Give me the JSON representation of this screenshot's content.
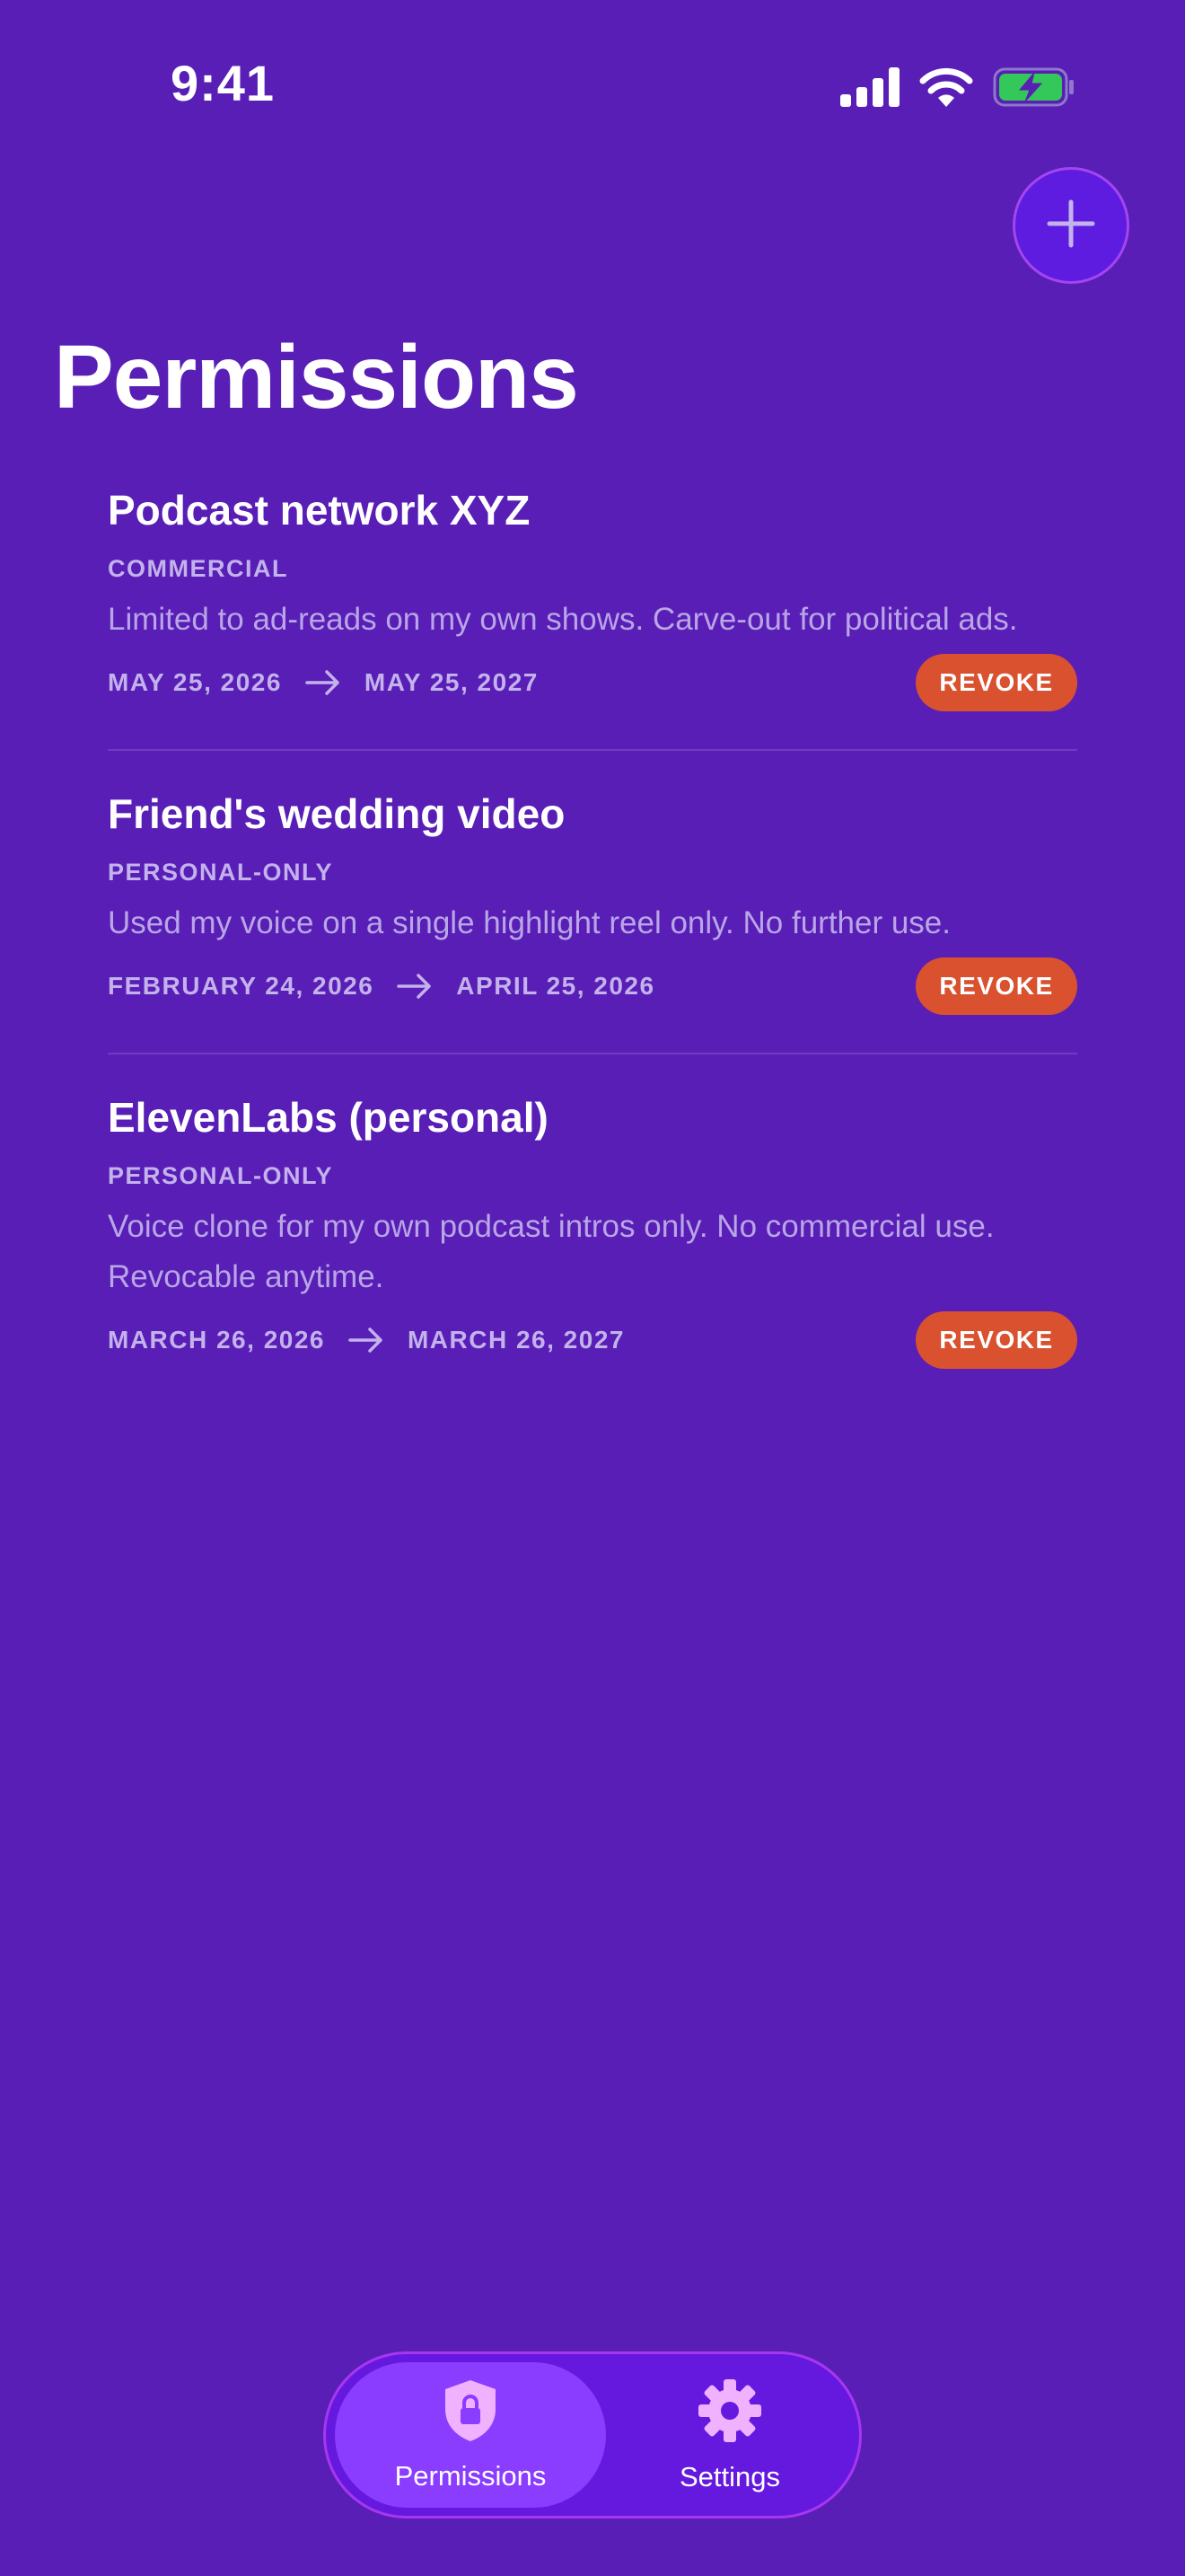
{
  "status_bar": {
    "time": "9:41"
  },
  "header": {
    "title": "Permissions",
    "add_icon": "plus-icon"
  },
  "permissions": [
    {
      "name": "Podcast network XYZ",
      "type": "COMMERCIAL",
      "description": "Limited to ad-reads on my own shows. Carve-out for political ads.",
      "start_date": "MAY 25, 2026",
      "end_date": "MAY 25, 2027",
      "action": "REVOKE"
    },
    {
      "name": "Friend's wedding video",
      "type": "PERSONAL-ONLY",
      "description": "Used my voice on a single highlight reel only. No further use.",
      "start_date": "FEBRUARY 24, 2026",
      "end_date": "APRIL 25, 2026",
      "action": "REVOKE"
    },
    {
      "name": "ElevenLabs (personal)",
      "type": "PERSONAL-ONLY",
      "description": "Voice clone for my own podcast intros only. No commercial use. Revocable anytime.",
      "start_date": "MARCH 26, 2026",
      "end_date": "MARCH 26, 2027",
      "action": "REVOKE"
    }
  ],
  "tab_bar": {
    "tabs": [
      {
        "label": "Permissions",
        "icon": "shield-lock-icon",
        "active": true
      },
      {
        "label": "Settings",
        "icon": "gear-icon",
        "active": false
      }
    ]
  },
  "colors": {
    "background": "#581eb6",
    "revoke": "#d9512f",
    "active_tab": "#8a3cff",
    "battery_fill": "#34c759"
  }
}
